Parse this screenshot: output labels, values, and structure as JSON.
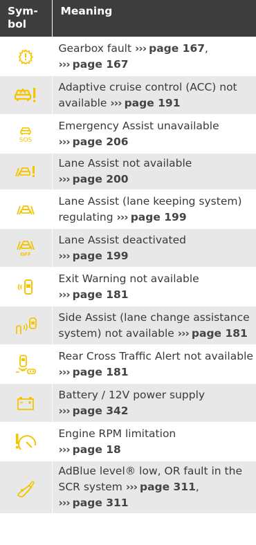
{
  "header": {
    "symbol": "Sym-bol",
    "meaning": "Meaning"
  },
  "arrow": "›››",
  "rows": [
    {
      "icon": "gearbox-fault-icon",
      "parts": [
        {
          "t": "Gearbox fault "
        },
        {
          "ref": "page 167"
        },
        {
          "t": ","
        },
        {
          "br": true
        },
        {
          "ref": "page 167"
        }
      ]
    },
    {
      "icon": "acc-unavailable-icon",
      "parts": [
        {
          "t": "Adaptive cruise control (ACC) not available "
        },
        {
          "ref": "page 191"
        }
      ]
    },
    {
      "icon": "emergency-assist-sos-icon",
      "icon_text": "SOS",
      "parts": [
        {
          "t": "Emergency Assist unavailable"
        },
        {
          "br": true
        },
        {
          "ref": "page 206"
        }
      ]
    },
    {
      "icon": "lane-assist-warning-icon",
      "parts": [
        {
          "t": "Lane Assist not available"
        },
        {
          "br": true
        },
        {
          "ref": "page 200"
        }
      ]
    },
    {
      "icon": "lane-assist-icon",
      "parts": [
        {
          "t": "Lane Assist (lane keeping system) regulating "
        },
        {
          "ref": "page 199"
        }
      ]
    },
    {
      "icon": "lane-assist-off-icon",
      "icon_text": "OFF",
      "parts": [
        {
          "t": "Lane Assist deactivated"
        },
        {
          "br": true
        },
        {
          "ref": "page 199"
        }
      ]
    },
    {
      "icon": "exit-warning-icon",
      "parts": [
        {
          "t": "Exit Warning not available"
        },
        {
          "br": true
        },
        {
          "ref": "page 181"
        }
      ]
    },
    {
      "icon": "side-assist-icon",
      "parts": [
        {
          "t": "Side Assist (lane change assistance system) not available "
        },
        {
          "ref": "page 181"
        }
      ]
    },
    {
      "icon": "rear-cross-traffic-icon",
      "parts": [
        {
          "t": "Rear Cross Traffic Alert not available"
        },
        {
          "br": true
        },
        {
          "ref": "page 181"
        }
      ]
    },
    {
      "icon": "battery-icon",
      "parts": [
        {
          "t": "Battery / 12V power supply"
        },
        {
          "br": true
        },
        {
          "ref": "page 342"
        }
      ]
    },
    {
      "icon": "engine-rpm-icon",
      "parts": [
        {
          "t": "Engine RPM limitation"
        },
        {
          "br": true
        },
        {
          "ref": "page 18"
        }
      ]
    },
    {
      "icon": "adblue-icon",
      "parts": [
        {
          "t": "AdBlue level® low, OR fault in the SCR system "
        },
        {
          "ref": "page 311"
        },
        {
          "t": ","
        },
        {
          "br": true
        },
        {
          "ref": "page 311"
        }
      ]
    }
  ],
  "colors": {
    "icon_yellow": "#f5c400",
    "header_bg": "#3d3d3d",
    "stripe": "#e8e8e8"
  }
}
